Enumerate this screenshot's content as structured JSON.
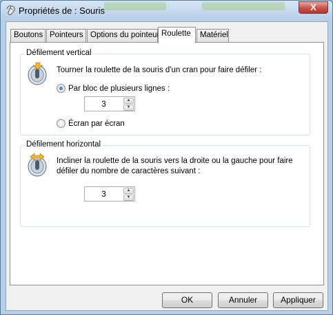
{
  "window": {
    "title": "Propriétés de : Souris",
    "close_glyph": "X"
  },
  "tabs": [
    {
      "label": "Boutons",
      "active": false
    },
    {
      "label": "Pointeurs",
      "active": false
    },
    {
      "label": "Options du pointeur",
      "active": false
    },
    {
      "label": "Roulette",
      "active": true
    },
    {
      "label": "Matériel",
      "active": false
    }
  ],
  "vertical": {
    "legend": "Défilement vertical",
    "description": "Tourner la roulette de la souris d'un cran pour faire défiler :",
    "icon": "mouse-wheel-vertical-icon",
    "option_lines": {
      "label": "Par bloc de plusieurs lignes :",
      "checked": true
    },
    "lines_value": "3",
    "option_screen": {
      "label": "Écran par écran",
      "checked": false
    }
  },
  "horizontal": {
    "legend": "Défilement horizontal",
    "description_line1": "Incliner la roulette de la souris vers la droite ou la gauche pour faire",
    "description_line2": "défiler du nombre de caractères suivant :",
    "icon": "mouse-wheel-horizontal-icon",
    "chars_value": "3"
  },
  "buttons": {
    "ok": "OK",
    "cancel": "Annuler",
    "apply": "Appliquer"
  },
  "colors": {
    "accent": "#1d5aa8",
    "titlebar": "#c3d7ee",
    "close": "#c75050"
  }
}
